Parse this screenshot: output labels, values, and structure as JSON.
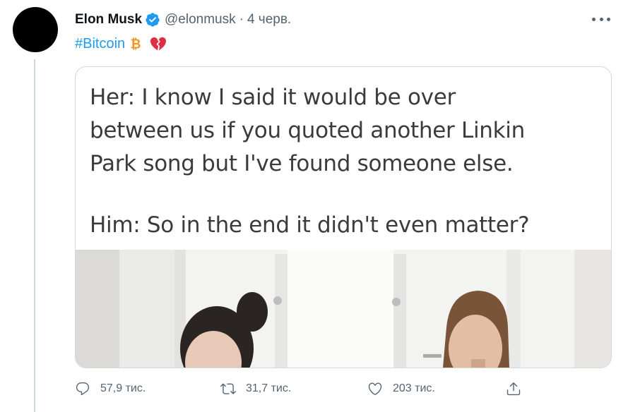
{
  "tweet": {
    "author_name": "Elon Musk",
    "handle": "@elonmusk",
    "separator": "·",
    "time": "4 черв.",
    "hashtag": "#Bitcoin",
    "icons": {
      "verified": "verified-badge-icon",
      "bitcoin": "bitcoin-icon",
      "heart": "broken-heart-icon",
      "more": "more-options-icon"
    },
    "accent_color": "#1d9bf0",
    "bitcoin_color": "#f7931a",
    "heart_color": "#dd2e44"
  },
  "media": {
    "lines": [
      "Her: I know I said it would be over",
      "between us if you quoted another Linkin",
      "Park song but I've found someone else.",
      "Him: So in the end it didn't even matter?"
    ]
  },
  "actions": {
    "reply_count": "57,9 тис.",
    "retweet_count": "31,7 тис.",
    "like_count": "203 тис.",
    "icons": [
      "reply-icon",
      "retweet-icon",
      "like-icon",
      "share-icon"
    ]
  }
}
